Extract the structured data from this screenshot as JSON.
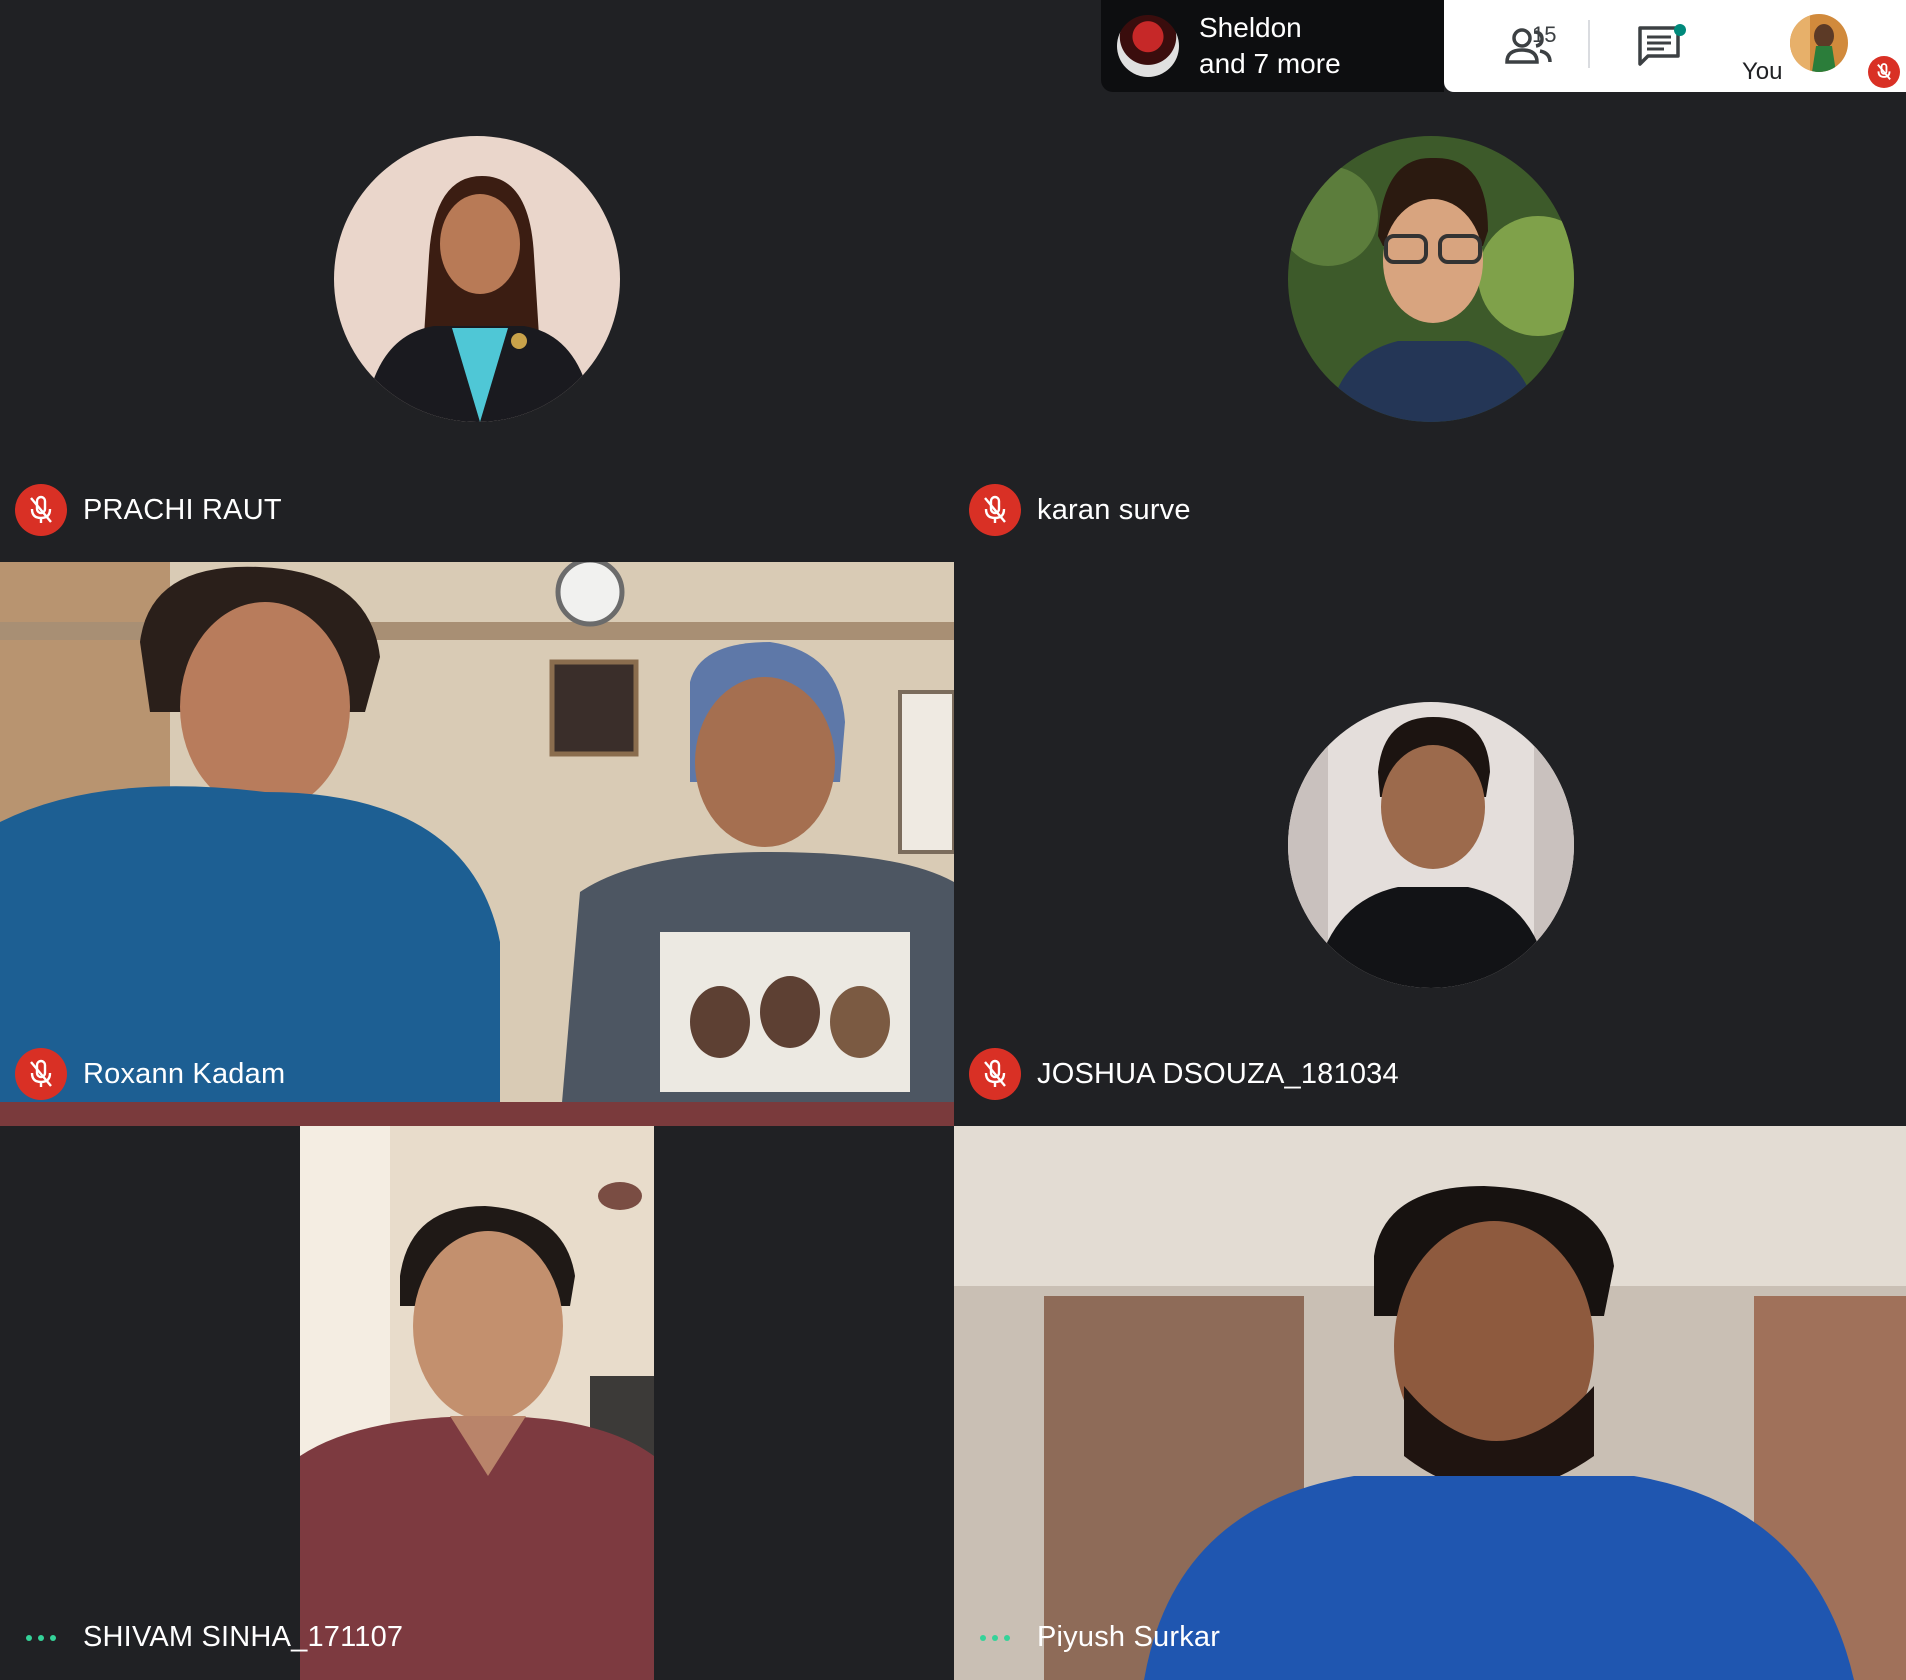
{
  "notification": {
    "line1": "Sheldon",
    "line2": "and 7 more"
  },
  "toolbar": {
    "participant_count": "15",
    "self_label": "You"
  },
  "participants": [
    {
      "name": "PRACHI RAUT",
      "status": "muted"
    },
    {
      "name": "karan surve",
      "status": "muted"
    },
    {
      "name": "Roxann Kadam",
      "status": "muted"
    },
    {
      "name": "JOSHUA DSOUZA_181034",
      "status": "muted"
    },
    {
      "name": "SHIVAM SINHA_171107",
      "status": "active"
    },
    {
      "name": "Piyush Surkar",
      "status": "active"
    }
  ],
  "colors": {
    "background": "#202124",
    "mute_red": "#d93025",
    "active_dots": "#34d399"
  }
}
